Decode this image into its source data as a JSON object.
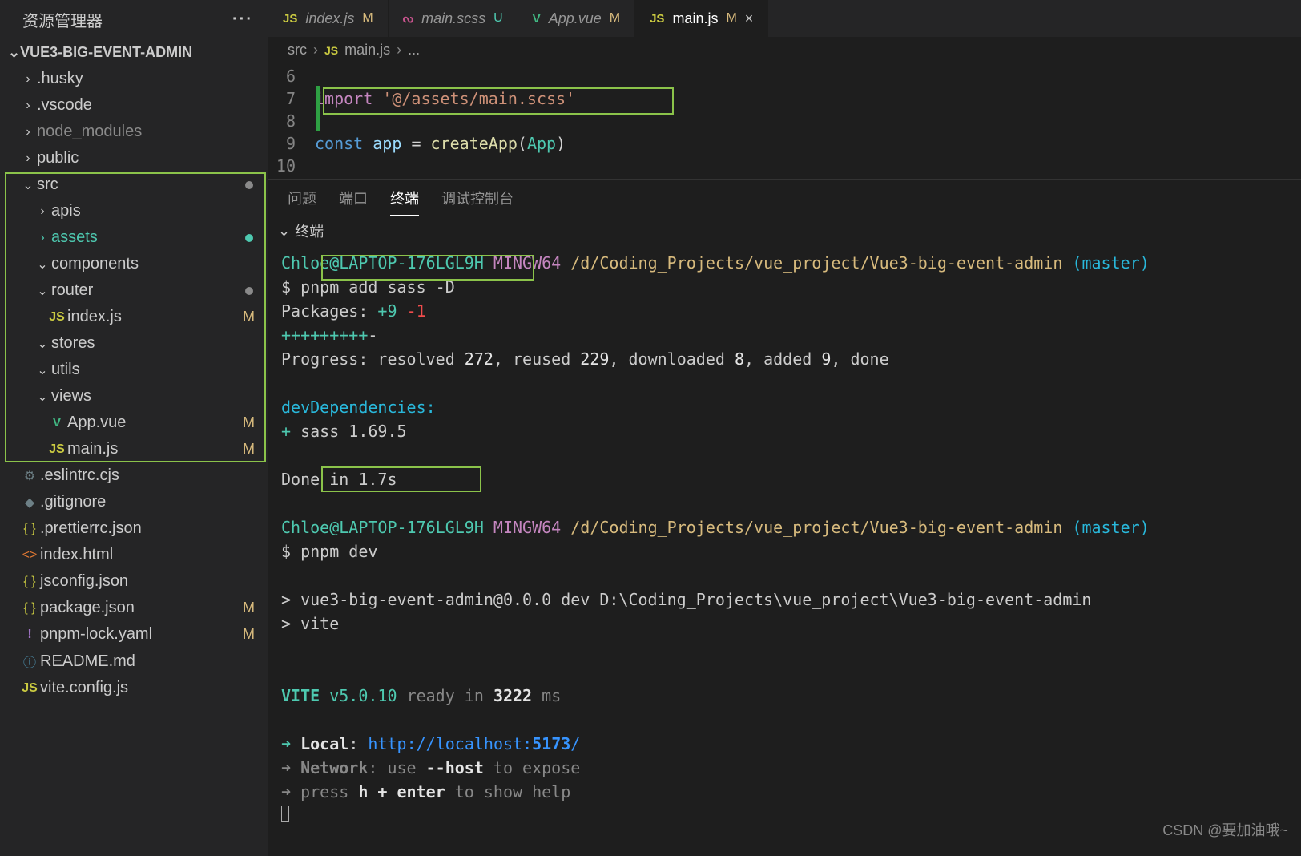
{
  "sidebar": {
    "title": "资源管理器",
    "project": "VUE3-BIG-EVENT-ADMIN",
    "tree": [
      {
        "chev": "›",
        "label": ".husky",
        "indent": 1
      },
      {
        "chev": "›",
        "label": ".vscode",
        "indent": 1
      },
      {
        "chev": "›",
        "label": "node_modules",
        "indent": 1,
        "dim": true
      },
      {
        "chev": "›",
        "label": "public",
        "indent": 1
      },
      {
        "chev": "⌄",
        "label": "src",
        "indent": 1,
        "dot": "grey"
      },
      {
        "chev": "›",
        "label": "apis",
        "indent": 2
      },
      {
        "chev": "›",
        "label": "assets",
        "indent": 2,
        "active": true,
        "dot": "green"
      },
      {
        "chev": "⌄",
        "label": "components",
        "indent": 2
      },
      {
        "chev": "⌄",
        "label": "router",
        "indent": 2,
        "dot": "grey"
      },
      {
        "icon": "JS",
        "iconCls": "fi-js",
        "label": "index.js",
        "indent": 3,
        "badge": "M"
      },
      {
        "chev": "⌄",
        "label": "stores",
        "indent": 2
      },
      {
        "chev": "⌄",
        "label": "utils",
        "indent": 2
      },
      {
        "chev": "⌄",
        "label": "views",
        "indent": 2
      },
      {
        "icon": "V",
        "iconCls": "fi-vue",
        "label": "App.vue",
        "indent": 3,
        "badge": "M"
      },
      {
        "icon": "JS",
        "iconCls": "fi-js",
        "label": "main.js",
        "indent": 3,
        "badge": "M"
      },
      {
        "icon": "⚙",
        "iconCls": "fi-gear",
        "label": ".eslintrc.cjs",
        "indent": 1
      },
      {
        "icon": "◆",
        "iconCls": "fi-gear",
        "label": ".gitignore",
        "indent": 1
      },
      {
        "icon": "{ }",
        "iconCls": "fi-json",
        "label": ".prettierrc.json",
        "indent": 1
      },
      {
        "icon": "<>",
        "iconCls": "fi-html",
        "label": "index.html",
        "indent": 1
      },
      {
        "icon": "{ }",
        "iconCls": "fi-json",
        "label": "jsconfig.json",
        "indent": 1
      },
      {
        "icon": "{ }",
        "iconCls": "fi-json",
        "label": "package.json",
        "indent": 1,
        "badge": "M"
      },
      {
        "icon": "!",
        "iconCls": "fi-excl",
        "label": "pnpm-lock.yaml",
        "indent": 1,
        "badge": "M"
      },
      {
        "icon": "ⓘ",
        "iconCls": "fi-info",
        "label": "README.md",
        "indent": 1
      },
      {
        "icon": "JS",
        "iconCls": "fi-js",
        "label": "vite.config.js",
        "indent": 1
      }
    ]
  },
  "tabs": [
    {
      "icon": "JS",
      "iconCls": "js",
      "label": "index.js",
      "badge": "M",
      "badgeCls": "m"
    },
    {
      "icon": "ᔓ",
      "iconCls": "scss",
      "label": "main.scss",
      "badge": "U",
      "badgeCls": "u"
    },
    {
      "icon": "V",
      "iconCls": "vue",
      "label": "App.vue",
      "badge": "M",
      "badgeCls": "m"
    },
    {
      "icon": "JS",
      "iconCls": "js",
      "label": "main.js",
      "badge": "M",
      "badgeCls": "m",
      "active": true,
      "close": true
    }
  ],
  "breadcrumb": {
    "root": "src",
    "icon": "JS",
    "file": "main.js",
    "tail": "..."
  },
  "code": {
    "lines": [
      {
        "n": "6",
        "html": ""
      },
      {
        "n": "7",
        "html": "<span class='tk-kw'>import</span> <span class='tk-str'>'@/assets/main.scss'</span>"
      },
      {
        "n": "8",
        "html": ""
      },
      {
        "n": "9",
        "html": "<span class='tk-const'>const</span> <span class='tk-var'>app</span> <span class='tk-plain'>=</span> <span class='tk-fn'>createApp</span><span class='tk-plain'>(</span><span class='tk-type'>App</span><span class='tk-plain'>)</span>"
      },
      {
        "n": "10",
        "html": ""
      }
    ]
  },
  "panel": {
    "tabs": [
      "问题",
      "端口",
      "终端",
      "调试控制台"
    ],
    "activeTab": 2,
    "subheader": "终端",
    "terminal_lines": [
      "<span class='term-green'>Chloe@LAPTOP-176LGL9H</span> <span class='term-purple'>MINGW64</span> <span class='term-yellow'>/d/Coding_Projects/vue_project/Vue3-big-event-admin</span> <span class='term-cyan2'>(master)</span>",
      "$ pnpm add sass -D",
      "Packages: <span class='term-green'>+9</span> <span class='term-red'>-1</span>",
      "<span class='term-green'>+++++++++</span>-",
      "Progress: resolved <span class='term-white'>272</span>, reused <span class='term-white'>229</span>, downloaded <span class='term-white'>8</span>, added <span class='term-white'>9</span>, done",
      "",
      "<span class='term-cyan2'>devDependencies:</span>",
      "<span class='term-green'>+</span> sass 1.69.5",
      "",
      "Done in 1.7s",
      "",
      "<span class='term-green'>Chloe@LAPTOP-176LGL9H</span> <span class='term-purple'>MINGW64</span> <span class='term-yellow'>/d/Coding_Projects/vue_project/Vue3-big-event-admin</span> <span class='term-cyan2'>(master)</span>",
      "$ pnpm dev",
      "",
      "&gt; vue3-big-event-admin@0.0.0 dev D:\\Coding_Projects\\vue_project\\Vue3-big-event-admin",
      "&gt; vite",
      "",
      "",
      "  <span class='term-green term-bold'>VITE</span> <span class='term-green'>v5.0.10</span>  <span class='term-grey'>ready in</span> <span class='term-white term-bold'>3222</span> <span class='term-grey'>ms</span>",
      "",
      "  <span class='term-green'>➜</span>  <span class='term-white term-bold'>Local</span>:   <span class='term-cyan'>http://localhost:</span><span class='term-cyan term-bold'>5173</span><span class='term-cyan'>/</span>",
      "  <span class='term-grey'>➜</span>  <span class='term-grey term-bold'>Network</span><span class='term-grey'>: use </span><span class='term-white term-bold'>--host</span><span class='term-grey'> to expose</span>",
      "  <span class='term-grey'>➜</span>  <span class='term-grey'>press </span><span class='term-white term-bold'>h + enter</span><span class='term-grey'> to show help</span>",
      "<span class='cursor-block'></span>"
    ]
  },
  "watermark": "CSDN @要加油哦~"
}
